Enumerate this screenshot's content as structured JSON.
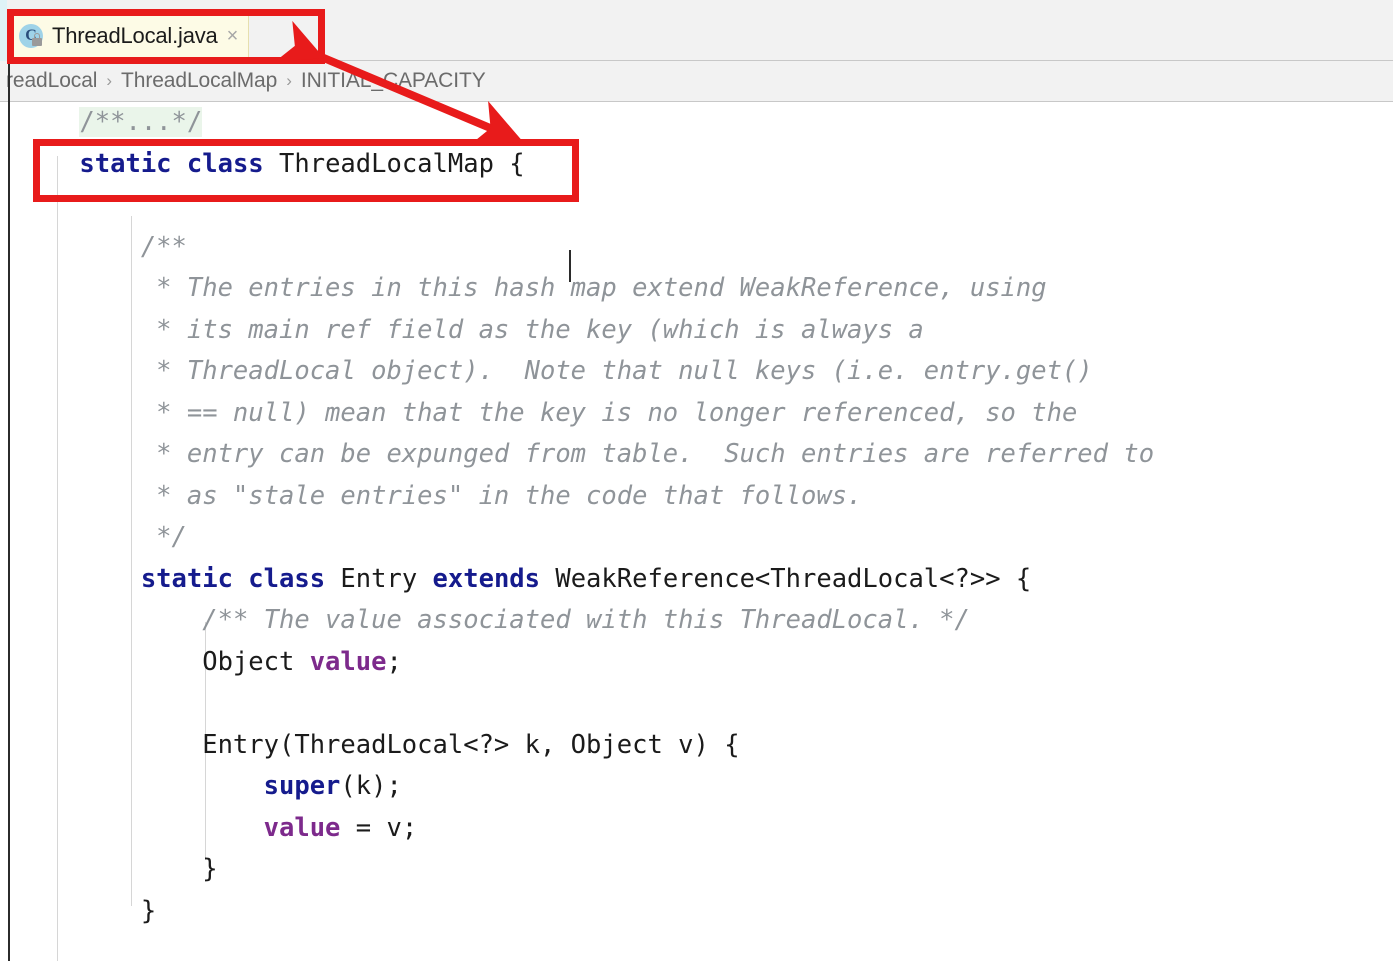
{
  "window": {
    "app": "IDE code editor"
  },
  "tab": {
    "icon": "java-class-icon",
    "icon_letter": "C",
    "label": "ThreadLocal.java",
    "close_glyph": "×"
  },
  "breadcrumb": {
    "items": [
      {
        "label": "readLocal"
      },
      {
        "label": "ThreadLocalMap"
      },
      {
        "label": "INITIAL_CAPACITY"
      }
    ],
    "separator": "›"
  },
  "colors": {
    "keyword": "#151b8d",
    "field": "#7d2a8c",
    "comment": "#8f9499",
    "annotation_red": "#e81b1b",
    "tab_background": "#fdfbe6",
    "fold_background": "#eaf5ea"
  },
  "code": {
    "lines": [
      {
        "id": "l1",
        "segments": [
          {
            "text": "    ",
            "style": "plain"
          },
          {
            "text": "/**...*/",
            "style": "fold"
          }
        ]
      },
      {
        "id": "l2",
        "segments": [
          {
            "text": "    ",
            "style": "plain"
          },
          {
            "text": "static class",
            "style": "kw"
          },
          {
            "text": " ThreadLocalMap {",
            "style": "plain"
          }
        ]
      },
      {
        "id": "l3",
        "segments": [
          {
            "text": "",
            "style": "plain"
          }
        ]
      },
      {
        "id": "l4",
        "segments": [
          {
            "text": "        ",
            "style": "plain"
          },
          {
            "text": "/**",
            "style": "cmt"
          }
        ]
      },
      {
        "id": "l5",
        "segments": [
          {
            "text": "         ",
            "style": "plain"
          },
          {
            "text": "* The entries in this hash map extend WeakReference, using",
            "style": "cmt"
          }
        ]
      },
      {
        "id": "l6",
        "segments": [
          {
            "text": "         ",
            "style": "plain"
          },
          {
            "text": "* its main ref field as the key (which is always a",
            "style": "cmt"
          }
        ]
      },
      {
        "id": "l7",
        "segments": [
          {
            "text": "         ",
            "style": "plain"
          },
          {
            "text": "* ThreadLocal object).  Note that null keys (i.e. entry.get()",
            "style": "cmt"
          }
        ]
      },
      {
        "id": "l8",
        "segments": [
          {
            "text": "         ",
            "style": "plain"
          },
          {
            "text": "* == null) mean that the key is no longer referenced, so the",
            "style": "cmt"
          }
        ]
      },
      {
        "id": "l9",
        "segments": [
          {
            "text": "         ",
            "style": "plain"
          },
          {
            "text": "* entry can be expunged from table.  Such entries are referred to",
            "style": "cmt"
          }
        ]
      },
      {
        "id": "l10",
        "segments": [
          {
            "text": "         ",
            "style": "plain"
          },
          {
            "text": "* as \"stale entries\" in the code that follows.",
            "style": "cmt"
          }
        ]
      },
      {
        "id": "l11",
        "segments": [
          {
            "text": "         ",
            "style": "plain"
          },
          {
            "text": "*/",
            "style": "cmt"
          }
        ]
      },
      {
        "id": "l12",
        "segments": [
          {
            "text": "        ",
            "style": "plain"
          },
          {
            "text": "static class",
            "style": "kw"
          },
          {
            "text": " Entry ",
            "style": "plain"
          },
          {
            "text": "extends",
            "style": "kw"
          },
          {
            "text": " WeakReference<ThreadLocal<?>> {",
            "style": "plain"
          }
        ]
      },
      {
        "id": "l13",
        "segments": [
          {
            "text": "            ",
            "style": "plain"
          },
          {
            "text": "/** The value associated with this ThreadLocal. */",
            "style": "cmt"
          }
        ]
      },
      {
        "id": "l14",
        "segments": [
          {
            "text": "            Object ",
            "style": "plain"
          },
          {
            "text": "value",
            "style": "field"
          },
          {
            "text": ";",
            "style": "plain"
          }
        ]
      },
      {
        "id": "l15",
        "segments": [
          {
            "text": "",
            "style": "plain"
          }
        ]
      },
      {
        "id": "l16",
        "segments": [
          {
            "text": "            Entry(ThreadLocal<?> k, Object v) {",
            "style": "plain"
          }
        ]
      },
      {
        "id": "l17",
        "segments": [
          {
            "text": "                ",
            "style": "plain"
          },
          {
            "text": "super",
            "style": "kw"
          },
          {
            "text": "(k);",
            "style": "plain"
          }
        ]
      },
      {
        "id": "l18",
        "segments": [
          {
            "text": "                ",
            "style": "plain"
          },
          {
            "text": "value",
            "style": "field"
          },
          {
            "text": " = v;",
            "style": "plain"
          }
        ]
      },
      {
        "id": "l19",
        "segments": [
          {
            "text": "            }",
            "style": "plain"
          }
        ]
      },
      {
        "id": "l20",
        "segments": [
          {
            "text": "        }",
            "style": "plain"
          }
        ]
      }
    ]
  },
  "annotations": {
    "highlight_boxes": [
      {
        "name": "tab-highlight",
        "target": "ThreadLocal.java"
      },
      {
        "name": "code-highlight",
        "target": "static class ThreadLocalMap"
      }
    ],
    "arrow": {
      "name": "pointer-arrow",
      "from": "ThreadLocal.java tab",
      "to": "static class ThreadLocalMap",
      "double_headed": true,
      "color": "#e81b1b"
    }
  }
}
